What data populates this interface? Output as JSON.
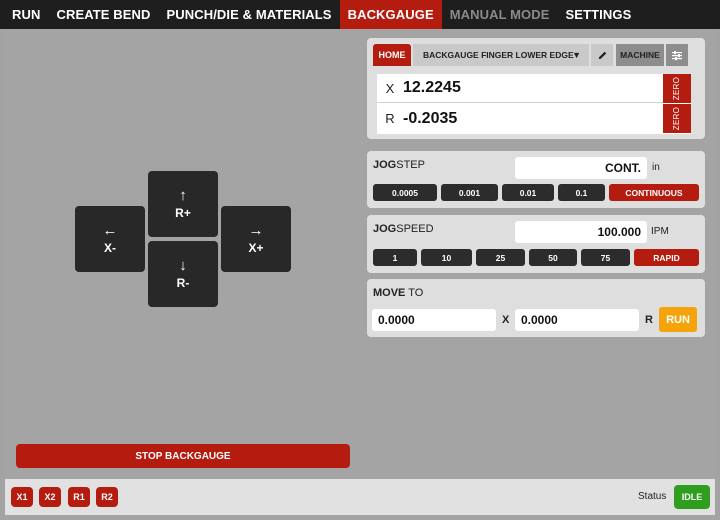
{
  "nav": {
    "items": [
      {
        "label": "RUN",
        "state": "normal"
      },
      {
        "label": "CREATE BEND",
        "state": "normal"
      },
      {
        "label": "PUNCH/DIE & MATERIALS",
        "state": "normal"
      },
      {
        "label": "BACKGAUGE",
        "state": "active"
      },
      {
        "label": "MANUAL MODE",
        "state": "disabled"
      },
      {
        "label": "SETTINGS",
        "state": "normal"
      }
    ]
  },
  "jog_pad": {
    "up": {
      "icon": "arrow-up-icon",
      "label": "R+"
    },
    "left": {
      "icon": "arrow-left-icon",
      "label": "X-"
    },
    "right": {
      "icon": "arrow-right-icon",
      "label": "X+"
    },
    "down": {
      "icon": "arrow-down-icon",
      "label": "R-"
    }
  },
  "stop_label": "STOP BACKGAUGE",
  "position": {
    "home_tab": "HOME",
    "reference": "BACKGAUGE FINGER LOWER EDGE",
    "machine_tab": "MACHINE",
    "axes": [
      {
        "name": "X",
        "value": "12.2245",
        "zero_label": "ZERO"
      },
      {
        "name": "R",
        "value": "-0.2035",
        "zero_label": "ZERO"
      }
    ]
  },
  "jog_step": {
    "title_bold": "JOG",
    "title_rest": "STEP",
    "value": "CONT.",
    "unit": "in",
    "options": [
      "0.0005",
      "0.001",
      "0.01",
      "0.1",
      "CONTINUOUS"
    ],
    "selected": "CONTINUOUS"
  },
  "jog_speed": {
    "title_bold": "JOG",
    "title_rest": "SPEED",
    "value": "100.000",
    "unit": "IPM",
    "options": [
      "1",
      "10",
      "25",
      "50",
      "75",
      "RAPID"
    ],
    "selected": "RAPID"
  },
  "move_to": {
    "title_bold": "MOVE",
    "title_rest": " TO",
    "x_value": "0.0000",
    "x_label": "X",
    "r_value": "0.0000",
    "r_label": "R",
    "run_label": "RUN"
  },
  "bottom": {
    "axis_chips": [
      "X1",
      "X2",
      "R1",
      "R2"
    ],
    "status_label": "Status",
    "status_value": "IDLE"
  },
  "colors": {
    "accent_red": "#b51c10",
    "run_orange": "#f5a30a",
    "idle_green": "#2f9e1f",
    "nav_dark": "#1e1e1e"
  }
}
